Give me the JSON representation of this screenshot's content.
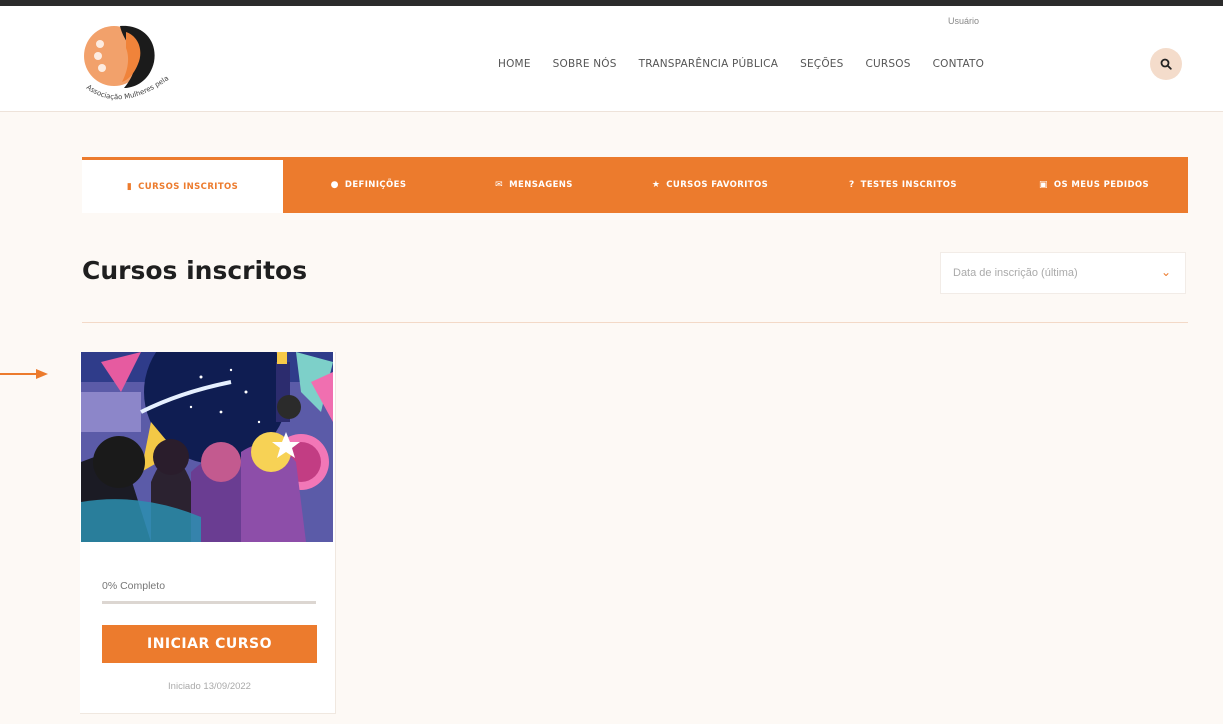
{
  "header": {
    "user_label": "Usuário",
    "logo_text": "Associação Mulheres pela Paz",
    "nav": [
      "HOME",
      "SOBRE NÓS",
      "TRANSPARÊNCIA PÚBLICA",
      "SEÇÕES",
      "CURSOS",
      "CONTATO"
    ],
    "search_icon": "search-icon"
  },
  "tabs": [
    {
      "label": "CURSOS INSCRITOS",
      "icon": "book-icon",
      "glyph": "▮",
      "active": true
    },
    {
      "label": "DEFINIÇÕES",
      "icon": "gear-icon",
      "glyph": "●",
      "active": false
    },
    {
      "label": "MENSAGENS",
      "icon": "envelope-icon",
      "glyph": "✉",
      "active": false
    },
    {
      "label": "CURSOS FAVORITOS",
      "icon": "star-icon",
      "glyph": "★",
      "active": false
    },
    {
      "label": "TESTES INSCRITOS",
      "icon": "question-icon",
      "glyph": "?",
      "active": false
    },
    {
      "label": "OS MEUS PEDIDOS",
      "icon": "basket-icon",
      "glyph": "▣",
      "active": false
    }
  ],
  "main": {
    "title": "Cursos inscritos",
    "sort": {
      "value": "Data de inscrição (última)",
      "icon": "chevron-down-icon"
    }
  },
  "courses": [
    {
      "progress_text": "0% Completo",
      "progress": 0,
      "button_label": "INICIAR CURSO",
      "enrolled_text": "Iniciado 13/09/2022"
    }
  ],
  "colors": {
    "accent": "#ec7b2d",
    "background": "#fdf9f5"
  }
}
